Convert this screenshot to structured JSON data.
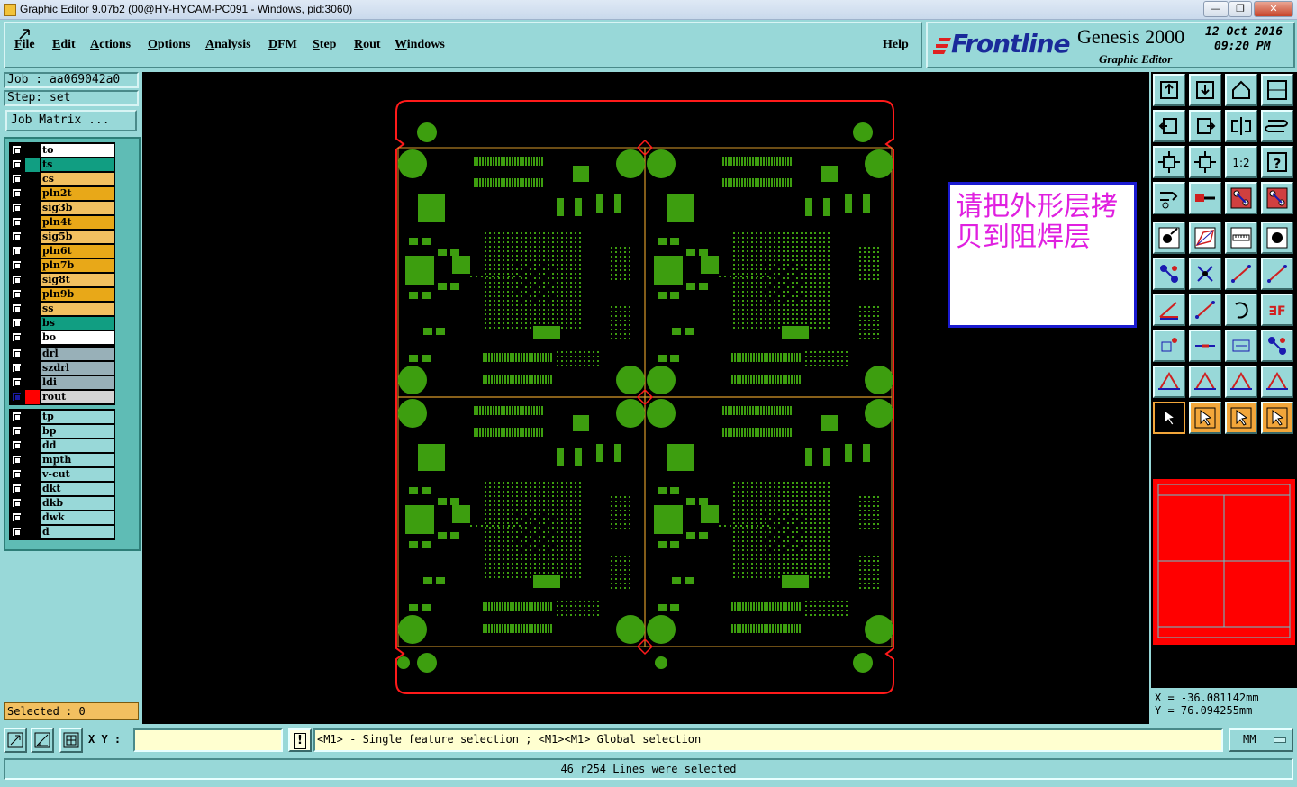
{
  "window": {
    "title": "Graphic Editor 9.07b2 (00@HY-HYCAM-PC091 - Windows, pid:3060)",
    "minimize": "—",
    "maximize": "❐",
    "close": "✕"
  },
  "menu": {
    "items": [
      {
        "label": "File",
        "u": "F",
        "rest": "ile"
      },
      {
        "label": "Edit",
        "u": "E",
        "rest": "dit"
      },
      {
        "label": "Actions",
        "u": "A",
        "rest": "ctions"
      },
      {
        "label": "Options",
        "u": "O",
        "rest": "ptions"
      },
      {
        "label": "Analysis",
        "u": "A",
        "rest": "nalysis"
      },
      {
        "label": "DFM",
        "u": "D",
        "rest": "FM"
      },
      {
        "label": "Step",
        "u": "S",
        "rest": "tep"
      },
      {
        "label": "Rout",
        "u": "R",
        "rest": "out"
      },
      {
        "label": "Windows",
        "u": "W",
        "rest": "indows"
      }
    ],
    "help": "Help"
  },
  "logo": {
    "brand": "Frontline",
    "product": "Genesis 2000",
    "subtitle": "Graphic Editor",
    "date": "12 Oct 2016",
    "time": "09:20 PM"
  },
  "job": {
    "job_line": "Job : aa069042a0",
    "step_line": "Step: set",
    "job_matrix": "Job Matrix ..."
  },
  "layers": {
    "groups": [
      [
        {
          "name": "to",
          "bg": "#ffffff",
          "color": "#000000"
        },
        {
          "name": "ts",
          "bg": "#119e82",
          "color": "#119e82"
        },
        {
          "name": "cs",
          "bg": "#f2c060",
          "color": "#000000"
        },
        {
          "name": "pln2t",
          "bg": "#e8a818",
          "color": "#000000"
        },
        {
          "name": "sig3b",
          "bg": "#f2c060",
          "color": "#000000"
        },
        {
          "name": "pln4t",
          "bg": "#e8a818",
          "color": "#000000"
        },
        {
          "name": "sig5b",
          "bg": "#f2c060",
          "color": "#000000"
        },
        {
          "name": "pln6t",
          "bg": "#e8a818",
          "color": "#000000"
        },
        {
          "name": "pln7b",
          "bg": "#e8a818",
          "color": "#000000"
        },
        {
          "name": "sig8t",
          "bg": "#f2c060",
          "color": "#000000"
        },
        {
          "name": "pln9b",
          "bg": "#e8a818",
          "color": "#000000"
        },
        {
          "name": "ss",
          "bg": "#f2c060",
          "color": "#000000"
        },
        {
          "name": "bs",
          "bg": "#119e82",
          "color": "#000000"
        },
        {
          "name": "bo",
          "bg": "#ffffff",
          "color": "#000000"
        }
      ],
      [
        {
          "name": "drl",
          "bg": "#98b0b8",
          "color": "#000000"
        },
        {
          "name": "szdrl",
          "bg": "#98b0b8",
          "color": "#000000"
        },
        {
          "name": "ldi",
          "bg": "#98b0b8",
          "color": "#000000"
        },
        {
          "name": "rout",
          "bg": "#d4d4d4",
          "color": "#ff0000",
          "active": true
        }
      ],
      [
        {
          "name": "tp",
          "bg": "#98d8d8",
          "color": "#000000"
        },
        {
          "name": "bp",
          "bg": "#98d8d8",
          "color": "#000000"
        },
        {
          "name": "dd",
          "bg": "#98d8d8",
          "color": "#000000"
        },
        {
          "name": "mpth",
          "bg": "#98d8d8",
          "color": "#000000"
        },
        {
          "name": "v-cut",
          "bg": "#98d8d8",
          "color": "#000000"
        },
        {
          "name": "dkt",
          "bg": "#98d8d8",
          "color": "#000000"
        },
        {
          "name": "dkb",
          "bg": "#98d8d8",
          "color": "#000000"
        },
        {
          "name": "dwk",
          "bg": "#98d8d8",
          "color": "#000000"
        },
        {
          "name": "d",
          "bg": "#98d8d8",
          "color": "#000000"
        }
      ]
    ]
  },
  "selected": "Selected : 0",
  "note": {
    "text": "请把外形层拷贝到阻焊层"
  },
  "colors": {
    "pad_green": "#3d9e0f",
    "outline_red": "#ff1a1a",
    "profile_orange": "#d99a2a"
  },
  "toolbar": {
    "tools": [
      "zoom-home-icon",
      "zoom-page-icon",
      "home-icon",
      "window-icon",
      "pan-left-icon",
      "pan-right-icon",
      "mirror-icon",
      "step-icon",
      "zoom-fit-icon",
      "zoom-center-icon",
      "scale-1-2-icon",
      "help-icon",
      "measure-icon",
      "snap-icon",
      "layer-red-icon",
      "layer-red2-icon",
      "feature-icon",
      "polygon-icon",
      "ruler-icon",
      "dot-icon",
      "net-icon",
      "x-icon",
      "line-icon",
      "line2-icon",
      "angle-icon",
      "slash-icon",
      "arc-icon",
      "text-icon",
      "move-icon",
      "cut-icon",
      "dimension-icon",
      "group-icon",
      "triangle-icon",
      "triangle2-icon",
      "letter-a-icon",
      "letter-a2-icon",
      "select-pointer-icon",
      "select-pointer2-icon",
      "select-pointer3-icon",
      "select-route-icon"
    ],
    "labels": {
      "scale": "1:2",
      "help": "?"
    }
  },
  "coords": {
    "x": "X = -36.081142mm",
    "y": "Y = 76.094255mm"
  },
  "bottom": {
    "xy_label": "X Y :",
    "xy_value": "",
    "bang": "!",
    "hint": "<M1> - Single feature selection ; <M1><M1> Global selection",
    "units": "MM",
    "status": "46 r254 Lines were selected"
  }
}
